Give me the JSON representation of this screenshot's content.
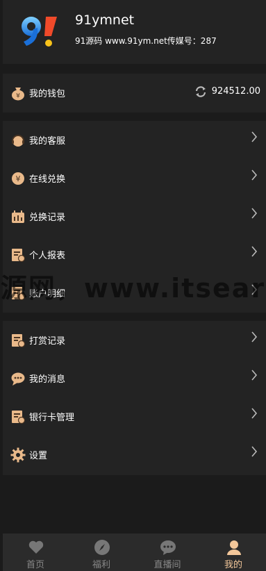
{
  "profile": {
    "username": "91ymnet",
    "subtitle": "91源码 www.91ym.net传媒号：287"
  },
  "wallet": {
    "label": "我的钱包",
    "balance": "924512.00"
  },
  "menu_group_1": [
    {
      "label": "我的客服",
      "icon": "headset-icon"
    },
    {
      "label": "在线兑换",
      "icon": "yuan-coin-icon"
    },
    {
      "label": "兑换记录",
      "icon": "calendar-icon"
    },
    {
      "label": "个人报表",
      "icon": "report-icon"
    },
    {
      "label": "账户明细",
      "icon": "report-icon"
    }
  ],
  "menu_group_2": [
    {
      "label": "打赏记录",
      "icon": "report-icon"
    },
    {
      "label": "我的消息",
      "icon": "chat-icon"
    },
    {
      "label": "银行卡管理",
      "icon": "report-icon"
    },
    {
      "label": "设置",
      "icon": "gear-icon"
    }
  ],
  "watermark": "源网，www.itsear",
  "tabs": [
    {
      "label": "首页",
      "icon": "heart-icon",
      "active": false
    },
    {
      "label": "福利",
      "icon": "compass-icon",
      "active": false
    },
    {
      "label": "直播间",
      "icon": "chat-bubble-icon",
      "active": false
    },
    {
      "label": "我的",
      "icon": "user-icon",
      "active": true
    }
  ],
  "colors": {
    "background": "#1b1b1b",
    "panel": "#232323",
    "accent": "#f3c79a",
    "tab_inactive": "#888888"
  }
}
